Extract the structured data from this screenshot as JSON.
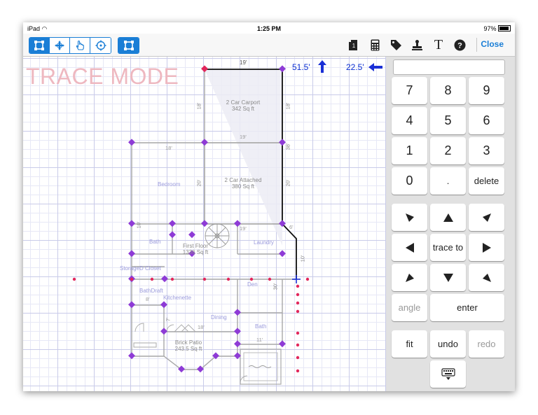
{
  "status": {
    "carrier": "iPad",
    "time": "1:25 PM",
    "battery": "97%"
  },
  "toolbar": {
    "close_label": "Close",
    "text_tool": "T",
    "tools_left": [
      {
        "name": "select-rect-icon",
        "active": true
      },
      {
        "name": "move-icon",
        "active": false
      },
      {
        "name": "hand-icon",
        "active": false
      },
      {
        "name": "target-icon",
        "active": false
      }
    ],
    "tool_single": {
      "name": "trace-rect-icon",
      "active": true
    }
  },
  "canvas": {
    "mode": "TRACE MODE",
    "readout_vertical": "51.5'",
    "readout_horizontal": "22.5'",
    "dims": {
      "top": "19'",
      "carport_left": "18'",
      "carport_right": "18'",
      "mid_top": "19'",
      "garage_left": "20'",
      "garage_right": "20'",
      "right_upper": "38'",
      "bedroom_top": "18'",
      "left_small": "10'",
      "diag": "6'",
      "garage_bottom": "19'",
      "right_lower": "10'",
      "den_side": "30'",
      "kitchen_small": "8'",
      "patio_top": "18'",
      "patio_left": "7'",
      "bath_small": "11'"
    },
    "rooms": {
      "carport_name": "2 Car Carport",
      "carport_area": "342 Sq ft",
      "garage_name": "2 Car Attached",
      "garage_area": "380 Sq ft",
      "bedroom": "Bedroom",
      "bath": "Bath",
      "laundry": "Laundry",
      "first_floor_name": "First Floor",
      "first_floor_area": "1336 Sq ft",
      "storage_closet": "StorageD Closet",
      "bath_draft": "BathDraft",
      "kitchenette": "Kitchenette",
      "den": "Den",
      "dining": "Dining",
      "bath2": "Bath",
      "patio_name": "Brick Patio",
      "patio_area": "243.5 Sq ft"
    }
  },
  "keypad": {
    "display": "",
    "digits": [
      "7",
      "8",
      "9",
      "4",
      "5",
      "6",
      "1",
      "2",
      "3",
      "0",
      "."
    ],
    "delete": "delete",
    "trace_to": "trace to",
    "angle": "angle",
    "enter": "enter",
    "fit": "fit",
    "undo": "undo",
    "redo": "redo"
  }
}
